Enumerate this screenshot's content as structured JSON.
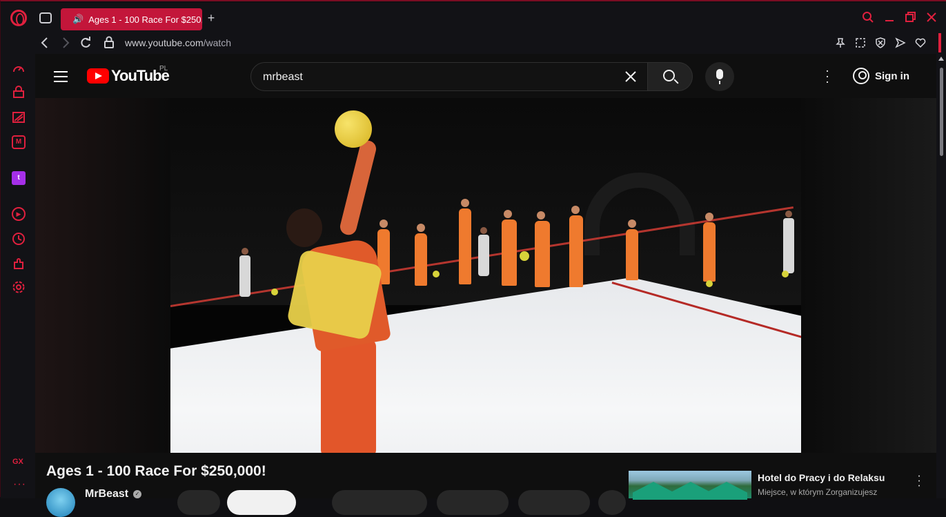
{
  "browser": {
    "tab": {
      "title": "Ages 1 - 100 Race For $250,000!"
    },
    "url": {
      "host": "www.youtube.com",
      "path": "/watch"
    },
    "colors": {
      "accent": "#e0203e",
      "tab_bg": "#c3163a"
    },
    "sidebar_icons": [
      "speed-dial-icon",
      "shopping-icon",
      "news-icon",
      "messenger-icon",
      "twitch-icon",
      "player-icon",
      "history-icon",
      "extensions-icon",
      "settings-icon"
    ],
    "sidebar_labels": {
      "gx": "GX",
      "more": "···"
    }
  },
  "youtube": {
    "logo_text": "YouTube",
    "country": "PL",
    "search": {
      "value": "mrbeast"
    },
    "signin_label": "Sign in",
    "video": {
      "title": "Ages 1 - 100 Race For $250,000!",
      "channel": "MrBeast"
    },
    "ad": {
      "title": "Hotel do Pracy i do Relaksu",
      "subtitle": "Miejsce, w którym Zorganizujesz"
    }
  }
}
